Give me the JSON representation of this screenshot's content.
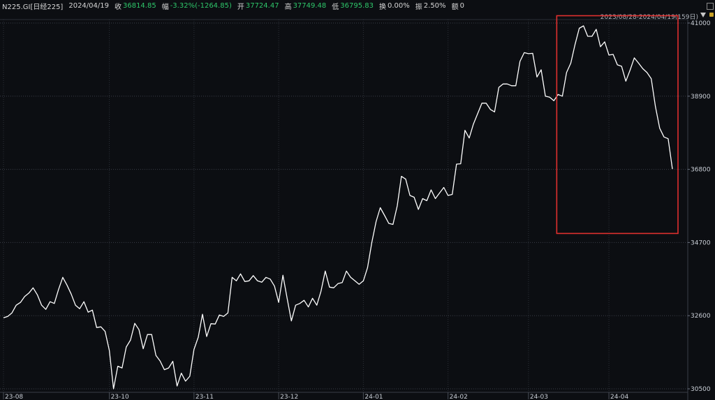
{
  "header": {
    "symbol": "N225.GI[日经225]",
    "date": "2024/04/19",
    "close_label": "收",
    "close_value": "36814.85",
    "change_label": "幅",
    "change_value": "-3.32%(-1264.85)",
    "open_label": "开",
    "open_value": "37724.47",
    "high_label": "高",
    "high_value": "37749.48",
    "low_label": "低",
    "low_value": "36795.83",
    "turnover_label": "换",
    "turnover_value": "0.00%",
    "amplitude_label": "振",
    "amplitude_value": "2.50%",
    "volume_label": "额",
    "volume_value": "0"
  },
  "range_text": "2023/08/28-2024/04/19(159日)",
  "colors": {
    "background": "#0c0e12",
    "line": "#ffffff",
    "highlight_box": "#e0302f",
    "green": "#2ec76a"
  },
  "chart_data": {
    "type": "line",
    "title": "",
    "xlabel": "",
    "ylabel": "",
    "ylim": [
      30400,
      41100
    ],
    "yticks": [
      30500,
      32600,
      34700,
      36800,
      38900,
      41000
    ],
    "xticks": [
      {
        "label": "23-08",
        "index": 0
      },
      {
        "label": "23-10",
        "index": 25
      },
      {
        "label": "23-11",
        "index": 45
      },
      {
        "label": "23-12",
        "index": 65
      },
      {
        "label": "24-01",
        "index": 85
      },
      {
        "label": "24-02",
        "index": 105
      },
      {
        "label": "24-03",
        "index": 124
      },
      {
        "label": "24-04",
        "index": 143
      }
    ],
    "highlight_range": {
      "from_index": 132,
      "to_index": 158,
      "y_from": 34960,
      "y_to": 41210
    },
    "series": [
      {
        "values": [
          32540,
          32580,
          32680,
          32900,
          32980,
          33150,
          33250,
          33400,
          33200,
          32900,
          32780,
          33000,
          32950,
          33350,
          33700,
          33480,
          33220,
          32900,
          32800,
          33000,
          32700,
          32760,
          32260,
          32280,
          32150,
          31600,
          30500,
          31150,
          31100,
          31700,
          31900,
          32380,
          32200,
          31650,
          32060,
          32060,
          31460,
          31300,
          31050,
          31100,
          31290,
          30580,
          30950,
          30720,
          30860,
          31630,
          31980,
          32640,
          32000,
          32370,
          32360,
          32620,
          32580,
          32680,
          33700,
          33600,
          33800,
          33580,
          33600,
          33750,
          33600,
          33560,
          33700,
          33650,
          33450,
          32980,
          33760,
          33100,
          32450,
          32900,
          32950,
          33040,
          32850,
          33100,
          32900,
          33300,
          33880,
          33420,
          33400,
          33520,
          33550,
          33880,
          33700,
          33600,
          33500,
          33600,
          33980,
          34700,
          35300,
          35700,
          35480,
          35250,
          35220,
          35750,
          36600,
          36520,
          36050,
          36000,
          35650,
          35960,
          35900,
          36210,
          35960,
          36120,
          36280,
          36050,
          36080,
          36950,
          36960,
          37920,
          37700,
          38100,
          38400,
          38700,
          38700,
          38520,
          38450,
          39150,
          39250,
          39250,
          39200,
          39200,
          39900,
          40150,
          40120,
          40130,
          39450,
          39660,
          38900,
          38870,
          38770,
          38950,
          38900,
          39580,
          39850,
          40380,
          40850,
          40920,
          40620,
          40620,
          40820,
          40320,
          40460,
          40080,
          40100,
          39800,
          39760,
          39330,
          39650,
          40000,
          39850,
          39690,
          39580,
          39400,
          38600,
          37980,
          37730,
          37680,
          36810
        ]
      }
    ]
  }
}
